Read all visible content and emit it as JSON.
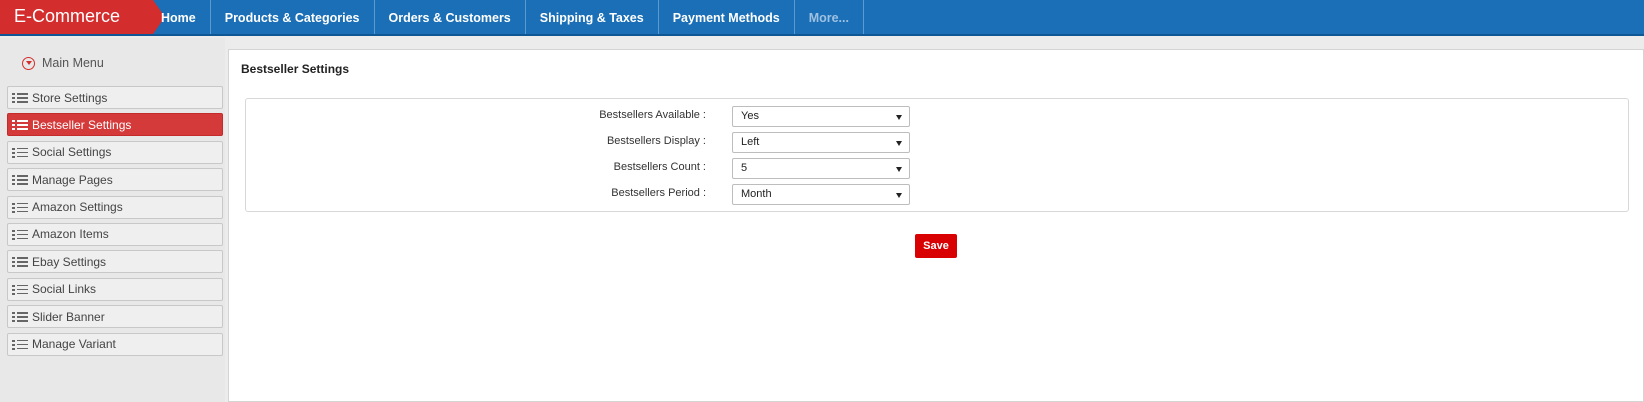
{
  "brand": "E-Commerce",
  "nav": [
    "Home",
    "Products & Categories",
    "Orders & Customers",
    "Shipping & Taxes",
    "Payment Methods",
    "More..."
  ],
  "sidebar": {
    "heading": "Main Menu",
    "items": [
      "Store Settings",
      "Bestseller Settings",
      "Social Settings",
      "Manage Pages",
      "Amazon Settings",
      "Amazon Items",
      "Ebay Settings",
      "Social Links",
      "Slider Banner",
      "Manage Variant"
    ],
    "active_index": 1
  },
  "main": {
    "title": "Bestseller Settings",
    "fields": [
      {
        "label": "Bestsellers Available :",
        "value": "Yes"
      },
      {
        "label": "Bestsellers Display :",
        "value": "Left"
      },
      {
        "label": "Bestsellers Count :",
        "value": "5"
      },
      {
        "label": "Bestsellers Period :",
        "value": "Month"
      }
    ],
    "save_label": "Save"
  },
  "colors": {
    "brand": "#d42d2d",
    "nav_bg": "#1a6fb6",
    "active_item": "#d53a3a",
    "save_button": "#d80000"
  }
}
